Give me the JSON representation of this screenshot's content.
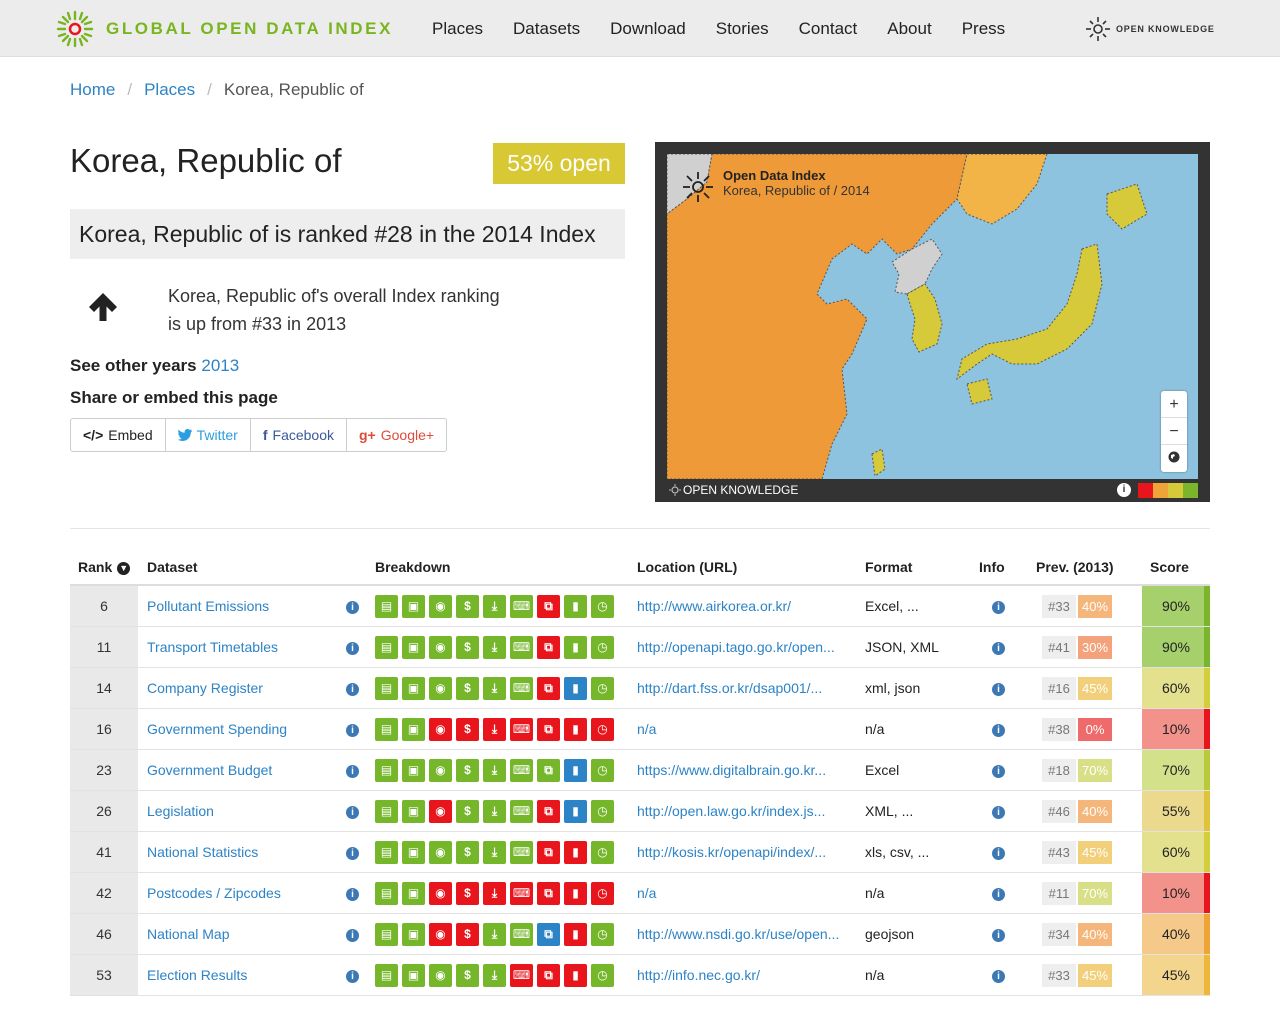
{
  "brand": {
    "name": "GLOBAL OPEN DATA INDEX",
    "partner": "OPEN KNOWLEDGE"
  },
  "nav": {
    "items": [
      "Places",
      "Datasets",
      "Download",
      "Stories",
      "Contact",
      "About",
      "Press"
    ]
  },
  "breadcrumb": {
    "home": "Home",
    "places": "Places",
    "current": "Korea, Republic of"
  },
  "place": {
    "title": "Korea, Republic of",
    "open_badge": "53% open",
    "rank_text": "Korea, Republic of is ranked #28 in the 2014 Index",
    "rank_change_line1": "Korea, Republic of's overall Index ranking",
    "rank_change_line2": "is up from #33 in 2013",
    "other_years_label": "See other years",
    "other_years_link": "2013",
    "share_title": "Share or embed this page"
  },
  "share": {
    "embed": "Embed",
    "twitter": "Twitter",
    "facebook": "Facebook",
    "google": "Google+"
  },
  "map": {
    "label_title": "Open Data Index",
    "label_sub": "Korea, Republic of / 2014",
    "zoom_in": "+",
    "zoom_out": "−",
    "footer": "OPEN KNOWLEDGE",
    "colors": {
      "sea": "#8ec3df",
      "land_orange": "#ef9a38",
      "land_light_orange": "#f2b347",
      "yellow": "#d6c93a",
      "grey": "#d0d0d0"
    }
  },
  "table": {
    "headers": {
      "rank": "Rank",
      "dataset": "Dataset",
      "breakdown": "Breakdown",
      "location": "Location (URL)",
      "format": "Format",
      "info": "Info",
      "prev": "Prev. (2013)",
      "score": "Score"
    },
    "rows": [
      {
        "rank": "6",
        "dataset": "Pollutant Emissions",
        "bd": "ggggggrgg",
        "url": "http://www.airkorea.or.kr/",
        "format": "Excel, ...",
        "prev_rank": "#33",
        "prev_score": "40%",
        "prev_color": "#f4b67a",
        "score": "90%",
        "score_bg": "#a6d06b",
        "score_bar": "#7ab52b"
      },
      {
        "rank": "11",
        "dataset": "Transport Timetables",
        "bd": "ggggggrgg",
        "url": "http://openapi.tago.go.kr/open...",
        "format": "JSON, XML",
        "prev_rank": "#41",
        "prev_score": "30%",
        "prev_color": "#f3a27c",
        "score": "90%",
        "score_bg": "#a6d06b",
        "score_bar": "#7ab52b"
      },
      {
        "rank": "14",
        "dataset": "Company Register",
        "bd": "ggggggrbg",
        "url": "http://dart.fss.or.kr/dsap001/...",
        "format": "xml, json",
        "prev_rank": "#16",
        "prev_score": "45%",
        "prev_color": "#f2cf7a",
        "score": "60%",
        "score_bg": "#e4e18e",
        "score_bar": "#d2ce3c"
      },
      {
        "rank": "16",
        "dataset": "Government Spending",
        "bd": "ggrrrrrrr",
        "url": "n/a",
        "format": "n/a",
        "prev_rank": "#38",
        "prev_score": "0%",
        "prev_color": "#ef6a6a",
        "score": "10%",
        "score_bg": "#f2928a",
        "score_bar": "#e8151c"
      },
      {
        "rank": "23",
        "dataset": "Government Budget",
        "bd": "gggggggbg",
        "url": "https://www.digitalbrain.go.kr...",
        "format": "Excel",
        "prev_rank": "#18",
        "prev_score": "70%",
        "prev_color": "#d8df86",
        "score": "70%",
        "score_bg": "#d2e18a",
        "score_bar": "#b9c93a"
      },
      {
        "rank": "26",
        "dataset": "Legislation",
        "bd": "ggrgggrbg",
        "url": "http://open.law.go.kr/index.js...",
        "format": "XML, ...",
        "prev_rank": "#46",
        "prev_score": "40%",
        "prev_color": "#f4b67a",
        "score": "55%",
        "score_bg": "#ebd98d",
        "score_bar": "#ddc43a"
      },
      {
        "rank": "41",
        "dataset": "National Statistics",
        "bd": "ggggggrrg",
        "url": "http://kosis.kr/openapi/index/...",
        "format": "xls, csv, ...",
        "prev_rank": "#43",
        "prev_score": "45%",
        "prev_color": "#f2cf7a",
        "score": "60%",
        "score_bg": "#e4e18e",
        "score_bar": "#d2ce3c"
      },
      {
        "rank": "42",
        "dataset": "Postcodes / Zipcodes",
        "bd": "ggrrrrrrr",
        "url": "n/a",
        "format": "n/a",
        "prev_rank": "#11",
        "prev_score": "70%",
        "prev_color": "#d8df86",
        "score": "10%",
        "score_bg": "#f2928a",
        "score_bar": "#e8151c"
      },
      {
        "rank": "46",
        "dataset": "National Map",
        "bd": "ggrrggbrg",
        "url": "http://www.nsdi.go.kr/use/open...",
        "format": "geojson",
        "prev_rank": "#34",
        "prev_score": "40%",
        "prev_color": "#f4b67a",
        "score": "40%",
        "score_bg": "#f4c98a",
        "score_bar": "#efa438"
      },
      {
        "rank": "53",
        "dataset": "Election Results",
        "bd": "gggggrrrg",
        "url": "http://info.nec.go.kr/",
        "format": "n/a",
        "prev_rank": "#33",
        "prev_score": "45%",
        "prev_color": "#f2cf7a",
        "score": "45%",
        "score_bg": "#f4d58e",
        "score_bar": "#efb738"
      }
    ]
  },
  "breakdown_icons": [
    "doc-icon",
    "save-icon",
    "eye-icon",
    "dollar-icon",
    "download-icon",
    "keyboard-icon",
    "copy-icon",
    "lock-icon",
    "clock-icon"
  ]
}
